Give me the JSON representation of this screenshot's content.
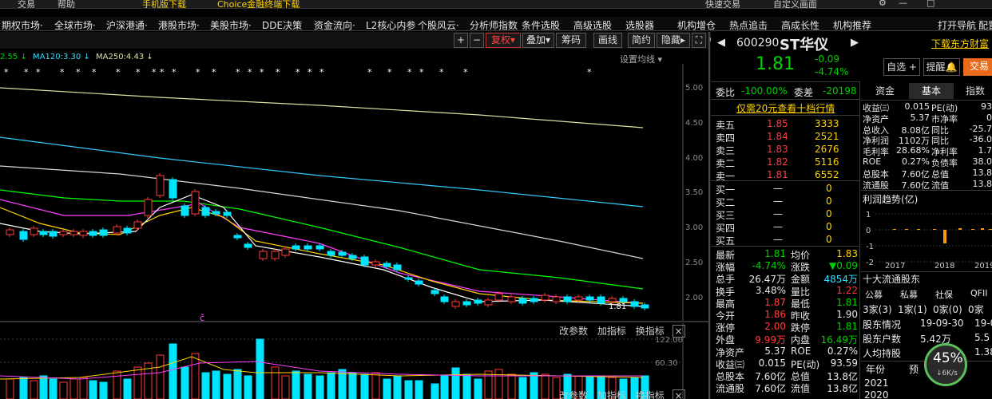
{
  "topbar": {
    "items": [
      "交易",
      "帮助",
      "手机版下载",
      "Choice金融终端下载",
      "快速交易",
      "自定义画面"
    ]
  },
  "menu": {
    "items": [
      "期权市场·",
      "全球市场·",
      "沪深港通·",
      "港股市场·",
      "美股市场·",
      "DDE决策",
      "资金流向·",
      "L2核心内参",
      "个股风云·",
      "分析师指数",
      "条件选股",
      "高级选股",
      "选股器",
      "机构增仓",
      "热点追击",
      "高成长性",
      "机构推荐",
      "打开导航",
      "配置"
    ]
  },
  "toolbar": {
    "plus": "+",
    "minus": "−",
    "fuquan": "复权",
    "diejia": "叠加",
    "chouma": "筹码",
    "huaxian": "画线",
    "jiandian": "简约",
    "yincang": "隐藏",
    "ma_setting": "设置均线"
  },
  "ma_legend": {
    "ma60": "2.55",
    "ma120": "MA120:3.30",
    "ma250": "MA250:4.43",
    "arrow": "↓"
  },
  "price_axis": [
    "5.00",
    "4.50",
    "4.00",
    "3.50",
    "3.00",
    "2.50",
    "2.00"
  ],
  "chart_marks": {
    "last_price_label": "1.81",
    "c_mark": "č"
  },
  "sub_toolbar": {
    "gai": "改参数",
    "jia": "加指标",
    "huan": "换指标",
    "close": "×"
  },
  "vol_axis": [
    "122.00",
    "60.30"
  ],
  "stock": {
    "code": "600290",
    "name": "ST华仪",
    "price": "1.81",
    "change": "-0.09",
    "pct": "-4.74%",
    "download": "下载东方财富",
    "zixuan": "自选 +",
    "tixing": "提醒",
    "jiaoyi": "交易"
  },
  "weibi": {
    "label1": "委比",
    "val1": "-100.00%",
    "label2": "委差",
    "val2": "-20198"
  },
  "l2_promo": "仅需20元查看十档行情",
  "asks": [
    {
      "l": "卖五",
      "p": "1.85",
      "v": "3333"
    },
    {
      "l": "卖四",
      "p": "1.84",
      "v": "2521"
    },
    {
      "l": "卖三",
      "p": "1.83",
      "v": "2676"
    },
    {
      "l": "卖二",
      "p": "1.82",
      "v": "5116"
    },
    {
      "l": "卖一",
      "p": "1.81",
      "v": "6552"
    }
  ],
  "bids": [
    {
      "l": "买一",
      "p": "—",
      "v": "0"
    },
    {
      "l": "买二",
      "p": "—",
      "v": "0"
    },
    {
      "l": "买三",
      "p": "—",
      "v": "0"
    },
    {
      "l": "买四",
      "p": "—",
      "v": "0"
    },
    {
      "l": "买五",
      "p": "—",
      "v": "0"
    }
  ],
  "quote": [
    {
      "a": "最新",
      "b": "1.81",
      "c": "均价",
      "d": "1.83"
    },
    {
      "a": "涨幅",
      "b": "-4.74%",
      "c": "涨跌",
      "d": "▼0.09"
    },
    {
      "a": "总手",
      "b": "26.47万",
      "c": "金额",
      "d": "4854万"
    },
    {
      "a": "换手",
      "b": "3.48%",
      "c": "量比",
      "d": "1.22"
    },
    {
      "a": "最高",
      "b": "1.87",
      "c": "最低",
      "d": "1.81"
    },
    {
      "a": "今开",
      "b": "1.86",
      "c": "昨收",
      "d": "1.90"
    },
    {
      "a": "涨停",
      "b": "2.00",
      "c": "跌停",
      "d": "1.81"
    },
    {
      "a": "外盘",
      "b": "9.99万",
      "c": "内盘",
      "d": "16.49万"
    },
    {
      "a": "净资产",
      "b": "5.37",
      "c": "ROE",
      "d": "0.27%"
    },
    {
      "a": "收益㈢",
      "b": "0.015",
      "c": "PE(动)",
      "d": "93.59"
    },
    {
      "a": "总股本",
      "b": "7.60亿",
      "c": "总值",
      "d": "13.8亿"
    },
    {
      "a": "流通股",
      "b": "7.60亿",
      "c": "流值",
      "d": "13.8亿"
    }
  ],
  "tabs": {
    "t1": "资金",
    "t2": "基本",
    "t3": "指数"
  },
  "fund": [
    {
      "a": "收益㈢",
      "b": "0.015",
      "c": "PE(动)",
      "d": "93"
    },
    {
      "a": "净资产",
      "b": "5.37",
      "c": "市净率",
      "d": "0"
    },
    {
      "a": "总收入",
      "b": "8.08亿",
      "c": "同比",
      "d": "-25.7"
    },
    {
      "a": "净利润",
      "b": "1102万",
      "c": "同比",
      "d": "-36.0"
    },
    {
      "a": "毛利率",
      "b": "28.68%",
      "c": "净利率",
      "d": "1.7"
    },
    {
      "a": "ROE",
      "b": "0.27%",
      "c": "负债率",
      "d": "38.0"
    },
    {
      "a": "总股本",
      "b": "7.60亿",
      "c": "总值",
      "d": "13.8"
    },
    {
      "a": "流通股",
      "b": "7.60亿",
      "c": "流值",
      "d": "13.8"
    }
  ],
  "profit": {
    "title": "利润趋势(亿)",
    "yticks": [
      "1",
      "0",
      "-1",
      "-2"
    ],
    "years": [
      "2017",
      "2018",
      "2019"
    ]
  },
  "holders": {
    "title": "十大流通股东",
    "cols": [
      "公募",
      "私募",
      "社保",
      "QFII"
    ],
    "vals": [
      "3家(3)",
      "1家(1)",
      "0家(0)",
      "0家"
    ],
    "rows": [
      {
        "a": "股东情况",
        "b": "19-09-30",
        "c": "19-06"
      },
      {
        "a": "股东户数",
        "b": "5.42万",
        "c": "5.5"
      },
      {
        "a": "人均持股",
        "b": "",
        "c": "1.38"
      }
    ]
  },
  "forecast": {
    "c1": "年份",
    "c2": "预",
    "y1": "2021",
    "y2": "2020"
  },
  "badge": {
    "pct": "45%",
    "speed": "6K/s"
  },
  "colors": {
    "up": "#ff3b3b",
    "down": "#00e5ff",
    "ma5": "#ffffff",
    "ma10": "#ffd200",
    "ma20": "#ff3fff",
    "ma60": "#00ff00",
    "ma120": "#33ccff",
    "ma250": "#e0e0a0"
  }
}
